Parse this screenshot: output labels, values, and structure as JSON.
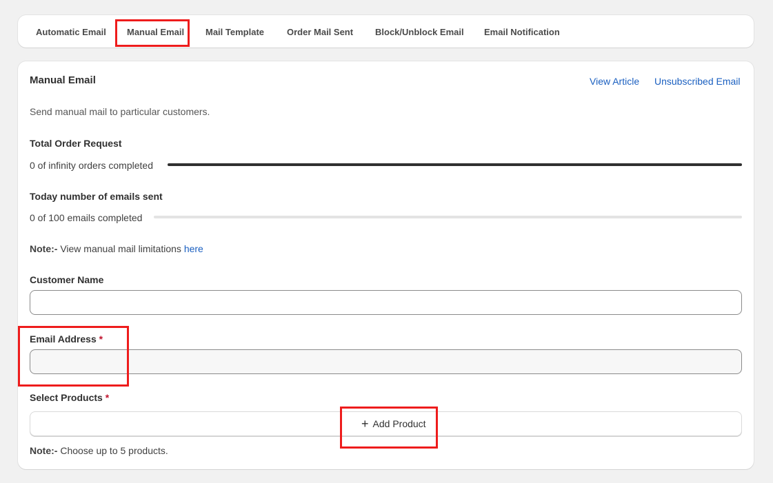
{
  "tabs": [
    {
      "label": "Automatic Email"
    },
    {
      "label": "Manual Email"
    },
    {
      "label": "Mail Template"
    },
    {
      "label": "Order Mail Sent"
    },
    {
      "label": "Block/Unblock Email"
    },
    {
      "label": "Email Notification"
    }
  ],
  "active_tab": "Manual Email",
  "card": {
    "title": "Manual Email",
    "view_article": "View Article",
    "unsubscribed_email": "Unsubscribed Email",
    "description": "Send manual mail to particular customers."
  },
  "order_request": {
    "heading": "Total Order Request",
    "status": "0 of infinity orders completed",
    "progress": 1.0
  },
  "emails_sent": {
    "heading": "Today number of emails sent",
    "status": "0 of 100 emails completed",
    "progress": 0.0
  },
  "note1": {
    "prefix": "Note:-",
    "text": " View manual mail limitations ",
    "link": "here"
  },
  "customer_name": {
    "label": "Customer Name",
    "value": ""
  },
  "email_address": {
    "label": "Email Address",
    "required_mark": "*",
    "value": ""
  },
  "select_products": {
    "label": "Select Products",
    "required_mark": "*"
  },
  "add_product": {
    "label": "Add Product",
    "icon": "plus-icon"
  },
  "note2": {
    "prefix": "Note:-",
    "text": " Choose up to 5 products."
  },
  "colors": {
    "accent_link": "#1a5fc0",
    "highlight": "#ee1c1c",
    "required": "#c0152f"
  }
}
